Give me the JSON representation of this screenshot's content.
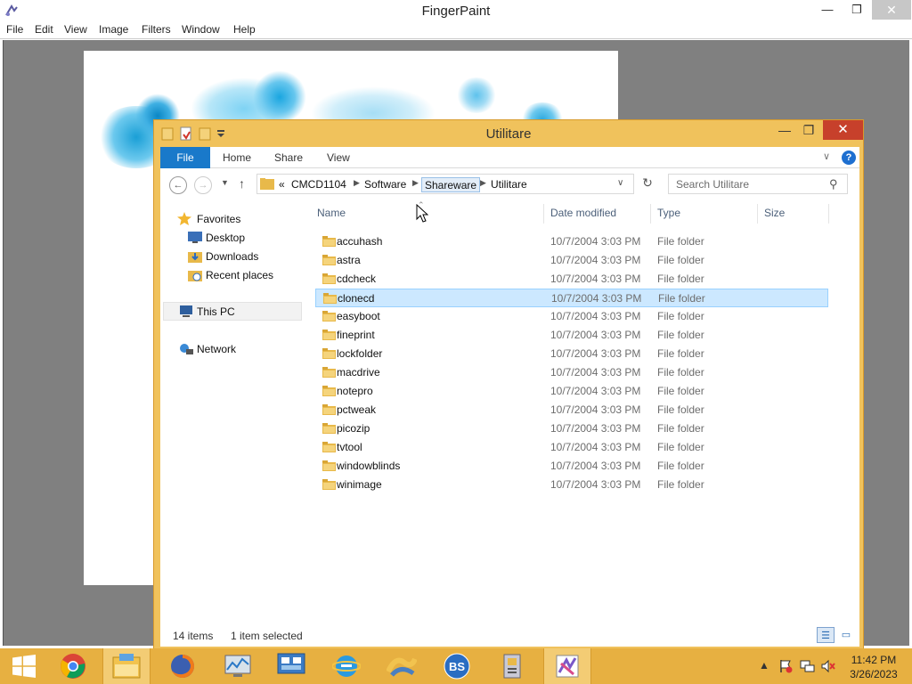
{
  "app": {
    "title": "FingerPaint",
    "menu": [
      "File",
      "Edit",
      "View",
      "Image",
      "Filters",
      "Window",
      "Help"
    ],
    "controls": {
      "minimize": "—",
      "maximize": "❐",
      "close": "✕"
    }
  },
  "explorer": {
    "title": "Utilitare",
    "ribbon_tabs": {
      "file": "File",
      "home": "Home",
      "share": "Share",
      "view": "View"
    },
    "address": {
      "overflow": "«",
      "crumbs": [
        "CMCD1104",
        "Software",
        "Shareware",
        "Utilitare"
      ]
    },
    "search_placeholder": "Search Utilitare",
    "nav": {
      "favorites": "Favorites",
      "desktop": "Desktop",
      "downloads": "Downloads",
      "recent": "Recent places",
      "this_pc": "This PC",
      "network": "Network"
    },
    "columns": {
      "name": "Name",
      "date": "Date modified",
      "type": "Type",
      "size": "Size"
    },
    "files": [
      {
        "name": "accuhash",
        "date": "10/7/2004 3:03 PM",
        "type": "File folder"
      },
      {
        "name": "astra",
        "date": "10/7/2004 3:03 PM",
        "type": "File folder"
      },
      {
        "name": "cdcheck",
        "date": "10/7/2004 3:03 PM",
        "type": "File folder"
      },
      {
        "name": "clonecd",
        "date": "10/7/2004 3:03 PM",
        "type": "File folder"
      },
      {
        "name": "easyboot",
        "date": "10/7/2004 3:03 PM",
        "type": "File folder"
      },
      {
        "name": "fineprint",
        "date": "10/7/2004 3:03 PM",
        "type": "File folder"
      },
      {
        "name": "lockfolder",
        "date": "10/7/2004 3:03 PM",
        "type": "File folder"
      },
      {
        "name": "macdrive",
        "date": "10/7/2004 3:03 PM",
        "type": "File folder"
      },
      {
        "name": "notepro",
        "date": "10/7/2004 3:03 PM",
        "type": "File folder"
      },
      {
        "name": "pctweak",
        "date": "10/7/2004 3:03 PM",
        "type": "File folder"
      },
      {
        "name": "picozip",
        "date": "10/7/2004 3:03 PM",
        "type": "File folder"
      },
      {
        "name": "tvtool",
        "date": "10/7/2004 3:03 PM",
        "type": "File folder"
      },
      {
        "name": "windowblinds",
        "date": "10/7/2004 3:03 PM",
        "type": "File folder"
      },
      {
        "name": "winimage",
        "date": "10/7/2004 3:03 PM",
        "type": "File folder"
      }
    ],
    "selected_index": 3,
    "status": {
      "items": "14 items",
      "selected": "1 item selected"
    }
  },
  "taskbar": {
    "apps": [
      "start-icon",
      "chrome-icon",
      "file-explorer-icon",
      "firefox-icon",
      "performance-monitor-icon",
      "network-admin-icon",
      "internet-explorer-icon",
      "paint-shop-icon",
      "bs-player-icon",
      "installer-icon",
      "fingerpaint-icon"
    ],
    "bs_label": "BS",
    "time": "11:42 PM",
    "date": "3/26/2023"
  },
  "colors": {
    "taskbar": "#e7b041",
    "explorer_frame": "#f0c25c",
    "close_red": "#c7402b",
    "file_tab_blue": "#1979ca",
    "selection": "#cce8ff"
  }
}
